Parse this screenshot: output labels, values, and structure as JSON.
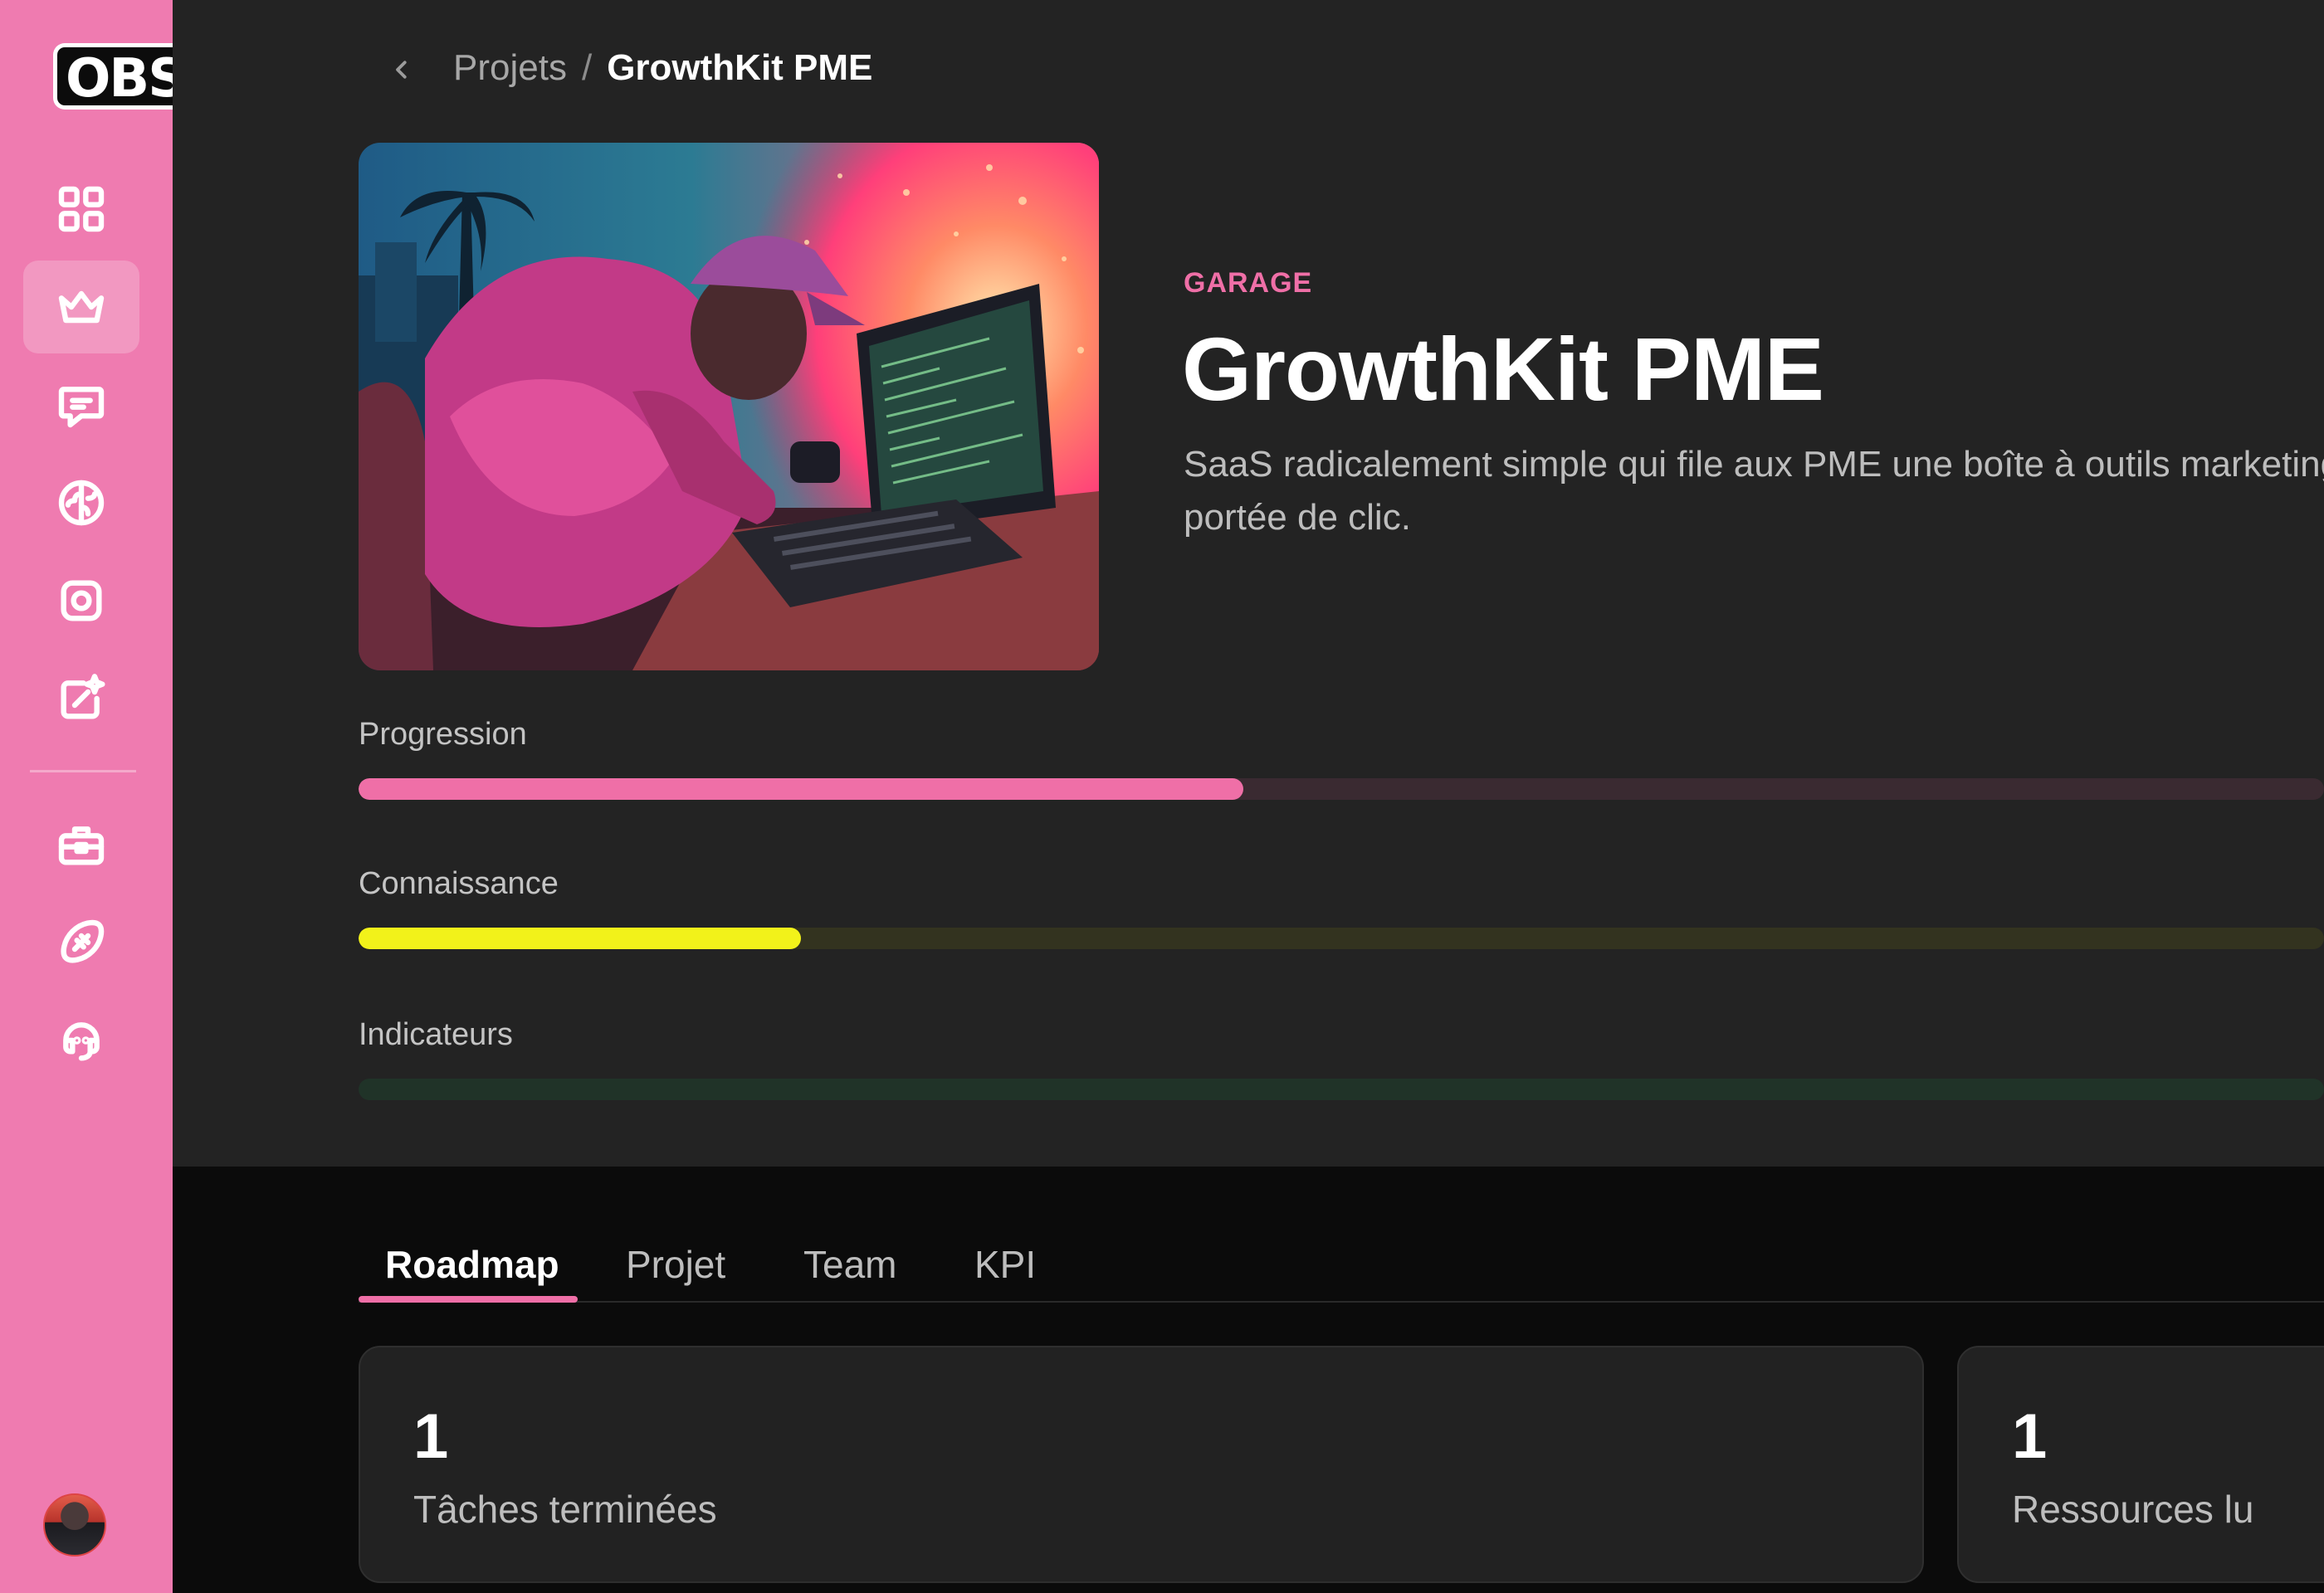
{
  "sidebar": {
    "logo_text": "OBS",
    "items": [
      {
        "icon": "grid-icon",
        "active": false
      },
      {
        "icon": "crown-icon",
        "active": true
      },
      {
        "icon": "chat-icon",
        "active": false
      },
      {
        "icon": "brain-icon",
        "active": false
      },
      {
        "icon": "square-circle-icon",
        "active": false
      },
      {
        "icon": "share-sparkle-icon",
        "active": false
      },
      {
        "icon": "toolbox-icon",
        "active": false
      },
      {
        "icon": "rugby-ball-icon",
        "active": false
      },
      {
        "icon": "support-headset-icon",
        "active": false
      }
    ]
  },
  "breadcrumb": {
    "parent": "Projets",
    "separator": "/",
    "current": "GrowthKit PME"
  },
  "project": {
    "category": "GARAGE",
    "title": "GrowthKit PME",
    "description": "SaaS radicalement simple qui file aux PME une boîte à outils marketing à portée de clic."
  },
  "meters": [
    {
      "label": "Progression",
      "fraction": 0.45,
      "fill_color": "#ef6fa7",
      "track_color": "#3a2a31"
    },
    {
      "label": "Connaissance",
      "fraction": 0.225,
      "fill_color": "#f2f21a",
      "track_color": "#33331f"
    },
    {
      "label": "Indicateurs",
      "fraction": 0.0,
      "fill_color": "#2fbf8a",
      "track_color": "#203328"
    }
  ],
  "tabs": [
    {
      "label": "Roadmap",
      "active": true
    },
    {
      "label": "Projet",
      "active": false
    },
    {
      "label": "Team",
      "active": false
    },
    {
      "label": "KPI",
      "active": false
    }
  ],
  "stats": [
    {
      "value": "1",
      "label": "Tâches terminées"
    },
    {
      "value": "1",
      "label": "Ressources lu"
    }
  ],
  "colors": {
    "sidebar": "#ef7bb0",
    "accent": "#ef6fa7",
    "background": "#232323"
  }
}
